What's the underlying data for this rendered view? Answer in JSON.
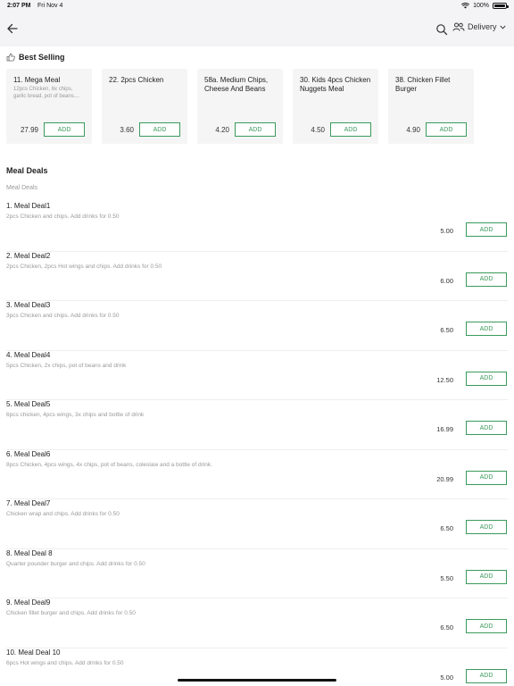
{
  "status_bar": {
    "time": "2:07 PM",
    "date": "Fri Nov 4",
    "battery": "100%",
    "battery_level": 1.0
  },
  "nav": {
    "back_icon": "back-arrow-icon",
    "search_icon": "search-icon",
    "people_icon": "people-icon",
    "mode": "Delivery"
  },
  "best_selling": {
    "title": "Best Selling",
    "icon": "thumbs-up-icon",
    "items": [
      {
        "name": "11. Mega Meal",
        "desc": "12pcs Chicken, 6x chips, garlic bread, pot of beans....",
        "price": "27.99",
        "add": "ADD"
      },
      {
        "name": "22. 2pcs Chicken",
        "desc": "",
        "price": "3.60",
        "add": "ADD"
      },
      {
        "name": "58a. Medium Chips, Cheese And Beans",
        "desc": "",
        "price": "4.20",
        "add": "ADD"
      },
      {
        "name": "30. Kids 4pcs Chicken Nuggets Meal",
        "desc": "",
        "price": "4.50",
        "add": "ADD"
      },
      {
        "name": "38. Chicken Fillet Burger",
        "desc": "",
        "price": "4.90",
        "add": "ADD"
      }
    ]
  },
  "meal_deals": {
    "title": "Meal Deals",
    "subtitle": "Meal Deals",
    "items": [
      {
        "name": "1. Meal Deal1",
        "desc": "2pcs Chicken and chips. Add drinks for 0.50",
        "price": "5.00",
        "add": "ADD"
      },
      {
        "name": "2. Meal Deal2",
        "desc": "2pcs Chicken, 2pcs Hot wings and chips. Add drinks for 0.50",
        "price": "6.00",
        "add": "ADD"
      },
      {
        "name": "3. Meal Deal3",
        "desc": "3pcs Chicken and chips. Add drinks for 0.50",
        "price": "6.50",
        "add": "ADD"
      },
      {
        "name": "4. Meal Deal4",
        "desc": "5pcs Chicken, 2x chips, pot of beans and drink",
        "price": "12.50",
        "add": "ADD"
      },
      {
        "name": "5. Meal Deal5",
        "desc": "6pcs chicken, 4pcs wings, 3x chips and bottle of drink",
        "price": "16.99",
        "add": "ADD"
      },
      {
        "name": "6. Meal Deal6",
        "desc": "8pcs Chicken, 4pcs wings, 4x chips, pot of beans, coleslaw and a bottle of drink.",
        "price": "20.99",
        "add": "ADD"
      },
      {
        "name": "7. Meal Deal7",
        "desc": "Chicken wrap and chips. Add drinks for 0.50",
        "price": "6.50",
        "add": "ADD"
      },
      {
        "name": "8. Meal Deal 8",
        "desc": "Quarter pounder burger and chips. Add drinks for 0.50",
        "price": "5.50",
        "add": "ADD"
      },
      {
        "name": "9. Meal Deal9",
        "desc": "Chicken fillet burger and chips. Add drinks for 0.50",
        "price": "6.50",
        "add": "ADD"
      },
      {
        "name": "10. Meal Deal 10",
        "desc": "6pcs Hot wings and chips. Add drinks for 0.50",
        "price": "5.00",
        "add": "ADD"
      }
    ]
  },
  "colors": {
    "accent": "#3a9a5c",
    "header_bg": "#f4f4f6",
    "card_bg": "#f5f5f5",
    "muted_text": "#999999"
  }
}
